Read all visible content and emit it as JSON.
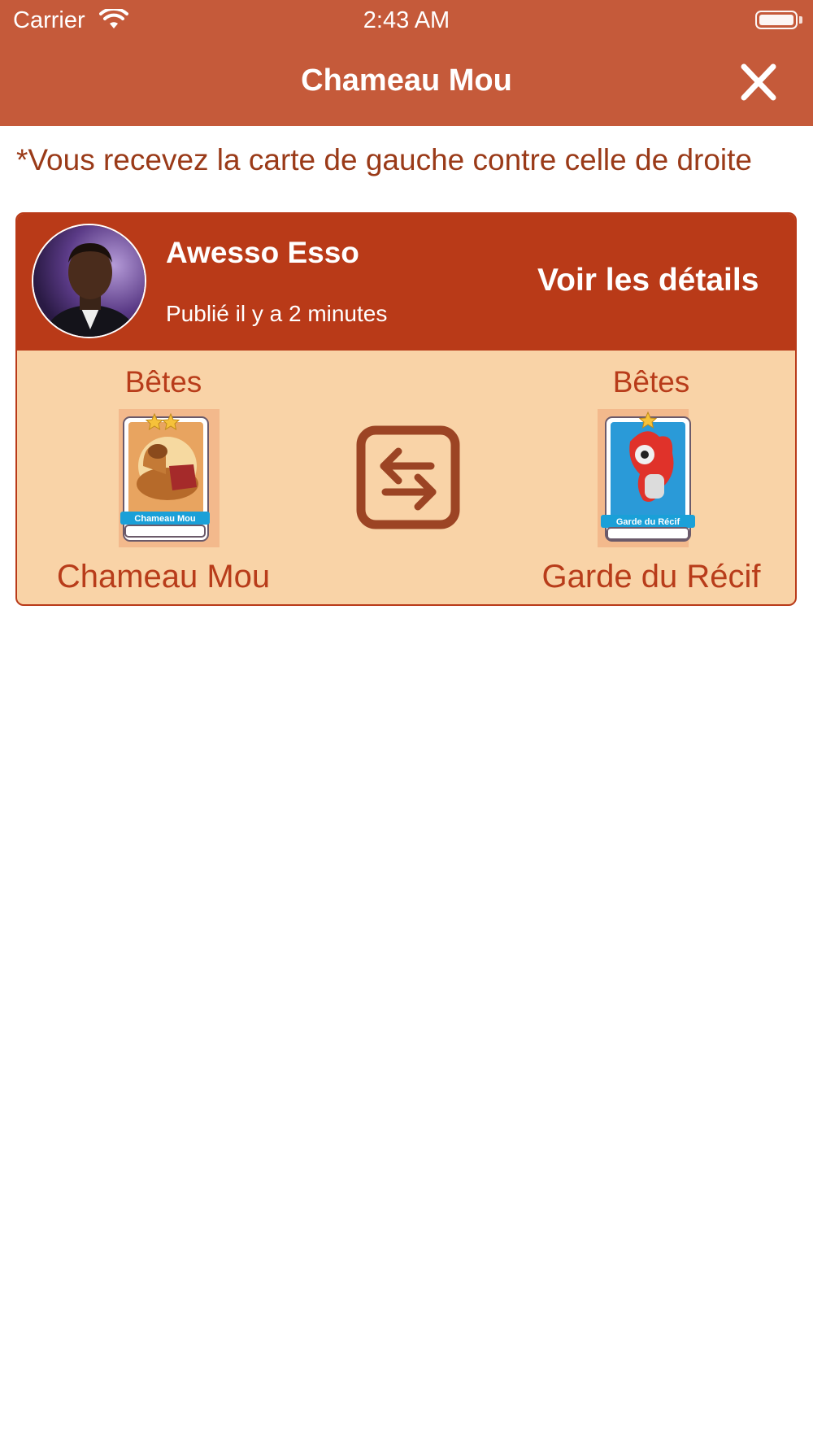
{
  "status_bar": {
    "carrier": "Carrier",
    "time": "2:43 AM"
  },
  "nav": {
    "title": "Chameau Mou"
  },
  "note": "*Vous recevez la carte de gauche contre celle de droite",
  "trade": {
    "user": {
      "name": "Awesso Esso",
      "published": "Publié il y a 2 minutes"
    },
    "details_label": "Voir les détails",
    "left_card": {
      "category": "Bêtes",
      "name": "Chameau Mou",
      "stars": 2,
      "banner": "Chameau Mou"
    },
    "right_card": {
      "category": "Bêtes",
      "name": "Garde du Récif",
      "stars": 1,
      "banner": "Garde du Récif"
    }
  },
  "icons": {
    "close": "close-icon",
    "swap": "swap-arrows-icon",
    "wifi": "wifi-icon",
    "battery": "battery-icon"
  },
  "colors": {
    "header": "#c55a3a",
    "card_header": "#b93a18",
    "card_body": "#f9d3a7",
    "accent_text": "#b83c1a",
    "swap_icon": "#9c4424"
  }
}
